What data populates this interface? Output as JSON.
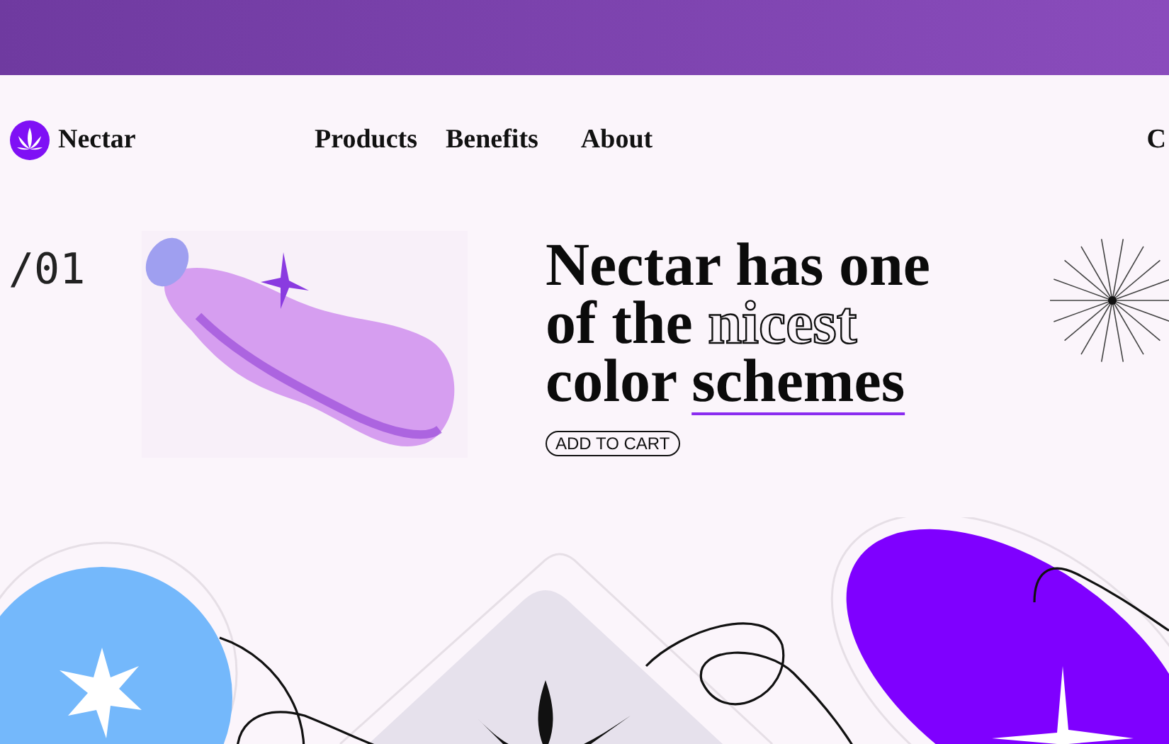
{
  "brand": {
    "name": "Nectar"
  },
  "nav": [
    {
      "label": "Products"
    },
    {
      "label": "Benefits"
    },
    {
      "label": "About"
    },
    {
      "label": "C"
    }
  ],
  "hero": {
    "index": "/01",
    "headline": [
      [
        {
          "text": "Nectar has one",
          "kind": "plain"
        }
      ],
      [
        {
          "text": "of the ",
          "kind": "plain"
        },
        {
          "text": "nicest",
          "kind": "outline"
        }
      ],
      [
        {
          "text": "color ",
          "kind": "plain"
        },
        {
          "text": "schemes",
          "kind": "underline"
        }
      ]
    ],
    "button": "ADD TO CART"
  }
}
